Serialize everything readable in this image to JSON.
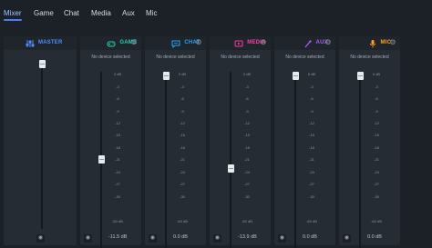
{
  "nav": {
    "tabs": [
      {
        "label": "Mixer",
        "active": true
      },
      {
        "label": "Game",
        "active": false
      },
      {
        "label": "Chat",
        "active": false
      },
      {
        "label": "Media",
        "active": false
      },
      {
        "label": "Aux",
        "active": false
      },
      {
        "label": "Mic",
        "active": false
      }
    ]
  },
  "colors": {
    "accent": "#4a7cff",
    "master": "#4f8cff",
    "game": "#1fd3b6",
    "chat": "#1fa8ff",
    "media": "#ff3aa6",
    "aux": "#b45cff",
    "mic": "#ffa21f"
  },
  "master": {
    "label": "MASTER",
    "icon": "sliders-icon",
    "level_percent": 100
  },
  "channels": [
    {
      "key": "game",
      "label": "GAME",
      "icon": "gamepad-icon",
      "device": "No device selected",
      "db": "-11.5 dB",
      "level_percent": 42
    },
    {
      "key": "chat",
      "label": "CHAT",
      "icon": "chat-bubble-icon",
      "device": "No device selected",
      "db": "0.0 dB",
      "level_percent": 100
    },
    {
      "key": "media",
      "label": "MEDIA",
      "icon": "play-icon",
      "device": "No device selected",
      "db": "-13.9 dB",
      "level_percent": 36
    },
    {
      "key": "aux",
      "label": "AUX",
      "icon": "magic-wand-icon",
      "device": "No device selected",
      "db": "0.0 dB",
      "level_percent": 100
    },
    {
      "key": "mic",
      "label": "MIC",
      "icon": "microphone-icon",
      "device": "No device selected",
      "db": "0.0 dB",
      "level_percent": 100
    }
  ],
  "scale": [
    "0 dB",
    "-3",
    "-6",
    "-9",
    "-12",
    "-15",
    "-18",
    "-21",
    "-24",
    "-27",
    "-30",
    "-60 dB"
  ]
}
